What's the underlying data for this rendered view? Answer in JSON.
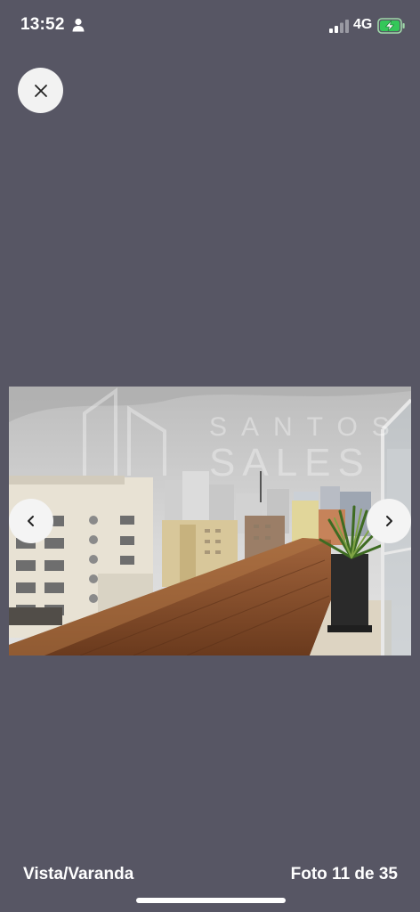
{
  "status_bar": {
    "time": "13:52",
    "network": "4G",
    "icons": [
      "person-icon",
      "signal-icon",
      "battery-charging-icon"
    ],
    "battery_color": "#34c759"
  },
  "viewer": {
    "close_icon": "close-icon",
    "prev_icon": "chevron-left-icon",
    "next_icon": "chevron-right-icon",
    "watermark": "SANTOS SALES",
    "caption": "Vista/Varanda",
    "counter": "Foto 11 de 35"
  },
  "colors": {
    "background": "#575664",
    "button": "#f4f4f4"
  }
}
